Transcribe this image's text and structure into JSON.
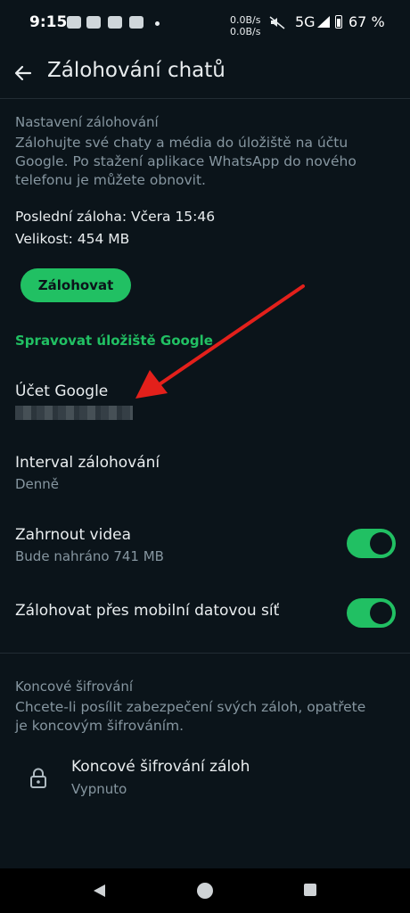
{
  "status_bar": {
    "time": "9:15",
    "net_up": "0.0B/s",
    "net_down": "0.0B/s",
    "network": "5G",
    "battery": "67 %",
    "icons": [
      "messenger-icon",
      "teams-icon",
      "excel-icon",
      "outlook-icon",
      "mute-icon",
      "signal-icon",
      "battery-icon"
    ]
  },
  "app_bar": {
    "title": "Zálohování chatů",
    "back_icon": "arrow-left-icon"
  },
  "backup": {
    "section_title": "Nastavení zálohování",
    "description": "Zálohujte své chaty a média do úložiště na účtu Google. Po stažení aplikace WhatsApp do nového telefonu je můžete obnovit.",
    "last_backup": "Poslední záloha: Včera 15:46",
    "size": "Velikost: 454 MB",
    "backup_button": "Zálohovat",
    "manage_storage_link": "Spravovat úložiště Google"
  },
  "settings": {
    "account": {
      "title": "Účet Google"
    },
    "interval": {
      "title": "Interval zálohování",
      "value": "Denně"
    },
    "videos": {
      "title": "Zahrnout videa",
      "subtitle": "Bude nahráno 741 MB",
      "enabled": true
    },
    "mobile_data": {
      "title": "Zálohovat přes mobilní datovou síť",
      "enabled": true
    }
  },
  "encryption": {
    "section_title": "Koncové šifrování",
    "description": "Chcete-li posílit zabezpečení svých záloh, opatřete je koncovým šifrováním.",
    "item_title": "Koncové šifrování záloh",
    "item_status": "Vypnuto",
    "icon": "lock-icon"
  },
  "navigation": {
    "icons": [
      "nav-back-icon",
      "nav-home-icon",
      "nav-recents-icon"
    ]
  },
  "colors": {
    "background": "#0b141a",
    "accent": "#21c063",
    "secondary_text": "#8696a0",
    "annotation_arrow": "#e3201b"
  }
}
